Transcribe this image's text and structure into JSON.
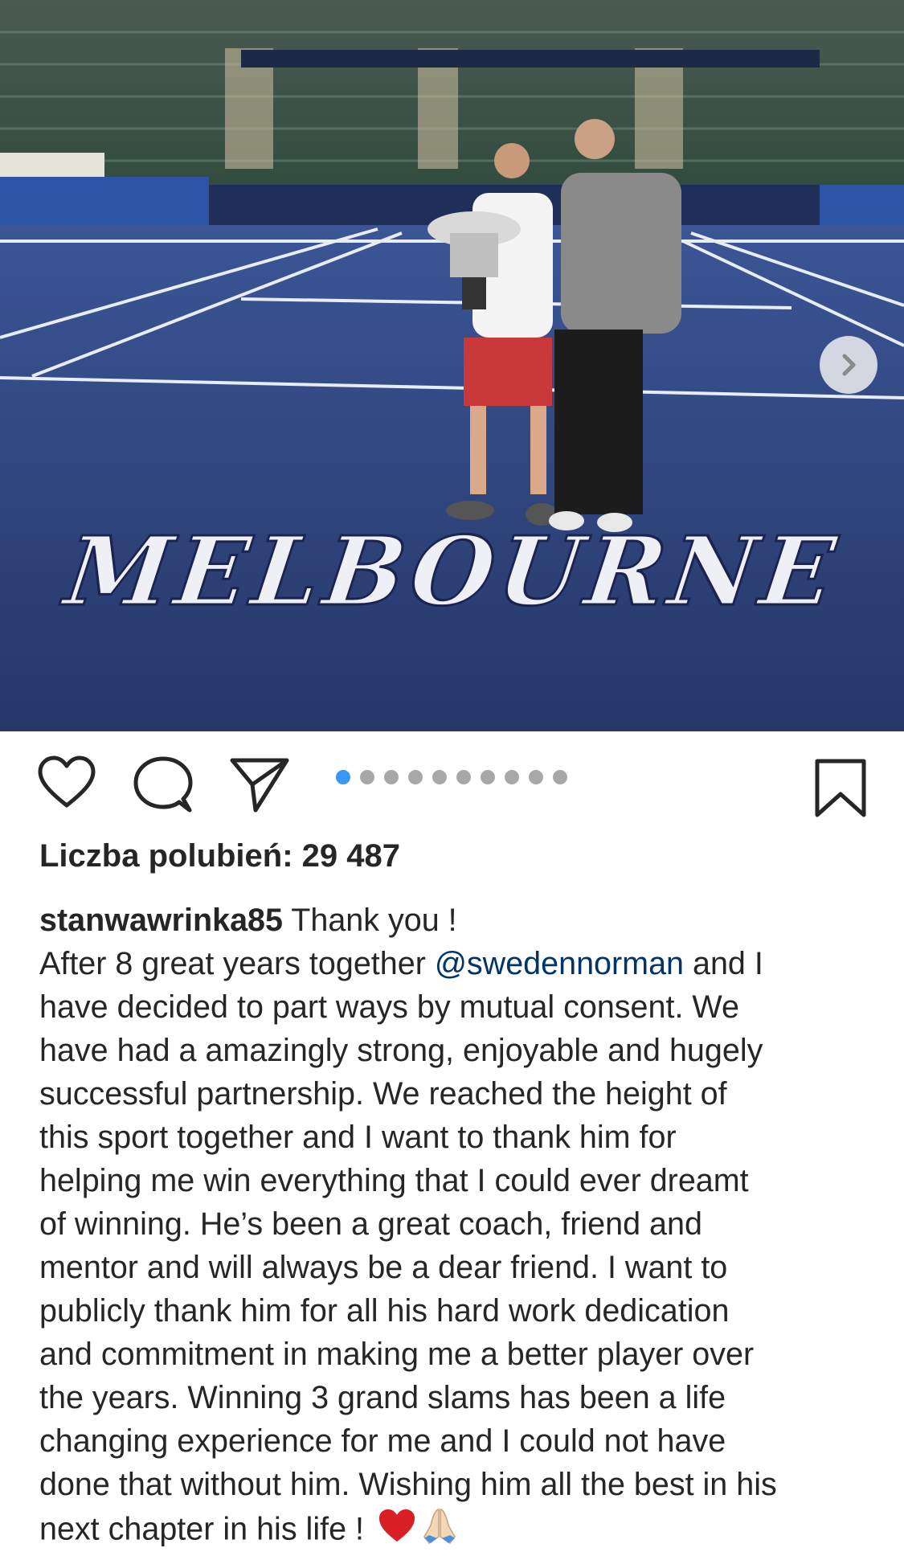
{
  "post": {
    "carousel": {
      "total": 10,
      "active_index": 0,
      "court_text": "MELBOURNE",
      "next_icon": "chevron-right-icon"
    },
    "actions": {
      "like_icon": "heart-icon",
      "comment_icon": "comment-icon",
      "share_icon": "paper-plane-icon",
      "save_icon": "bookmark-icon"
    },
    "likes_label": "Liczba polubień: 29 487",
    "caption": {
      "username": "stanwawrinka85",
      "first": " Thank you !",
      "line2_pre": "After 8 great years together ",
      "mention": "@swedennorman",
      "line2_post": " and I",
      "lines": [
        "have decided to part ways by mutual consent. We",
        "have had a amazingly strong, enjoyable and hugely",
        "successful partnership. We reached the height of",
        "this sport together and I want to thank him for",
        "helping me win everything that I could ever dreamt",
        "of winning. He’s been a great coach, friend and",
        "mentor and will always be a dear friend. I want to",
        "publicly thank him for all his hard work dedication",
        "and commitment in making me a better player over",
        "the years. Winning 3 grand slams has been a life",
        "changing experience for me and I could not have",
        "done that without him. Wishing him all the best in his"
      ],
      "last": "next chapter in his life ! ",
      "emojis": [
        "heart-emoji",
        "praying-hands-emoji"
      ]
    },
    "colors": {
      "mention": "#003569",
      "dot_active": "#3897f0",
      "dot_inactive": "#a8a8a8",
      "court": "#2d3f78"
    }
  }
}
